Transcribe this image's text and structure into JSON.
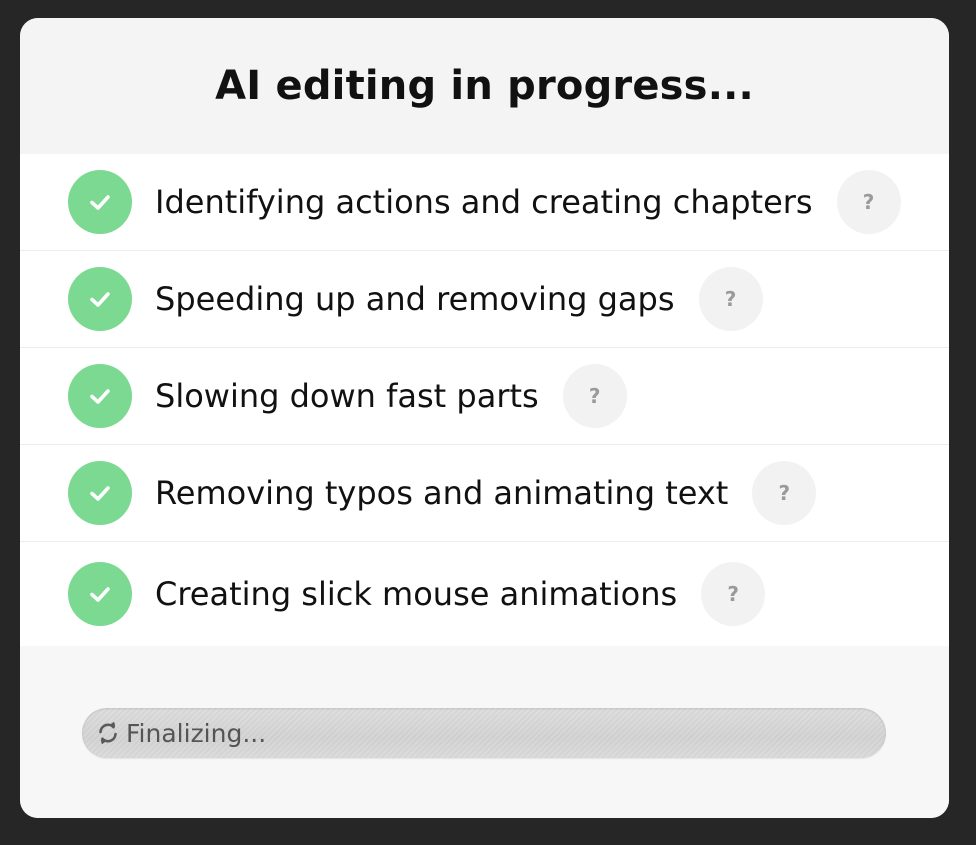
{
  "dialog": {
    "title": "AI editing in progress..."
  },
  "steps": [
    {
      "label": "Identifying actions and creating chapters",
      "status": "done",
      "help": "?"
    },
    {
      "label": "Speeding up and removing gaps",
      "status": "done",
      "help": "?"
    },
    {
      "label": "Slowing down fast parts",
      "status": "done",
      "help": "?"
    },
    {
      "label": "Removing typos and animating text",
      "status": "done",
      "help": "?"
    },
    {
      "label": "Creating slick mouse animations",
      "status": "done",
      "help": "?"
    }
  ],
  "progress": {
    "label": "Finalizing...",
    "icon": "refresh-icon",
    "fraction": 1.0
  },
  "colors": {
    "check_green": "#7cd992",
    "help_gray": "#9a9a9a",
    "backdrop": "#262626"
  }
}
